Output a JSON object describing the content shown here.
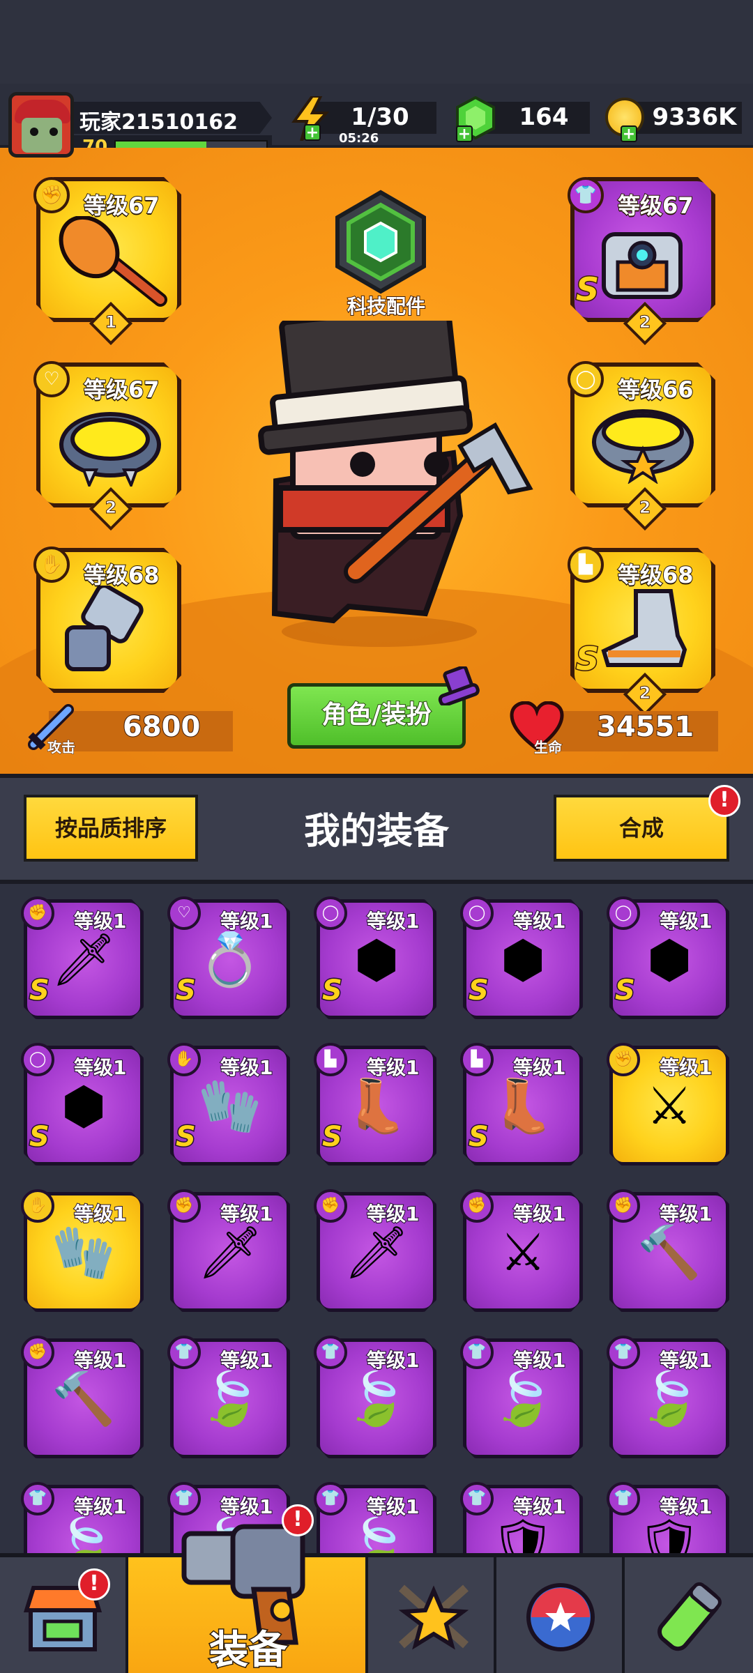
{
  "player": {
    "name": "玩家21510162",
    "level": "70",
    "xp_fraction": 0.6
  },
  "resources": {
    "energy": {
      "value": "1/30",
      "timer": "05:26",
      "icon": "lightning-icon"
    },
    "gems": {
      "value": "164",
      "icon": "green-gem-icon"
    },
    "coins": {
      "value": "9336K",
      "icon": "gold-coin-icon"
    }
  },
  "tech_parts": {
    "label": "科技配件"
  },
  "equipped": {
    "weapon": {
      "level": "等级67",
      "count": "1",
      "icon": "hammer-icon"
    },
    "necklace": {
      "level": "等级67",
      "count": "2",
      "icon": "spiked-collar-icon"
    },
    "gloves": {
      "level": "等级68",
      "count": "",
      "icon": "gauntlet-icon"
    },
    "armor": {
      "level": "等级67",
      "count": "2",
      "icon": "robot-armor-icon",
      "grade": "S"
    },
    "belt": {
      "level": "等级66",
      "count": "2",
      "icon": "star-belt-icon"
    },
    "boots": {
      "level": "等级68",
      "count": "2",
      "icon": "boot-icon",
      "grade": "S"
    }
  },
  "stats": {
    "attack_label": "攻击",
    "attack": "6800",
    "hp_label": "生命",
    "hp": "34551"
  },
  "role_button": "角色/装扮",
  "panel": {
    "sort_button": "按品质排序",
    "title": "我的装备",
    "merge_button": "合成",
    "merge_alert": "!"
  },
  "inventory": [
    {
      "level": "等级1",
      "grade": "S",
      "rarity": "purple",
      "slot": "weapon",
      "icon": "flame-sword-icon"
    },
    {
      "level": "等级1",
      "grade": "S",
      "rarity": "purple",
      "slot": "necklace",
      "icon": "star-ring-icon"
    },
    {
      "level": "等级1",
      "grade": "S",
      "rarity": "purple",
      "slot": "belt",
      "icon": "gem-belt-icon"
    },
    {
      "level": "等级1",
      "grade": "S",
      "rarity": "purple",
      "slot": "belt",
      "icon": "gem-belt-icon"
    },
    {
      "level": "等级1",
      "grade": "S",
      "rarity": "purple",
      "slot": "belt",
      "icon": "gem-belt-icon"
    },
    {
      "level": "等级1",
      "grade": "S",
      "rarity": "purple",
      "slot": "belt",
      "icon": "gem-belt-icon"
    },
    {
      "level": "等级1",
      "grade": "S",
      "rarity": "purple",
      "slot": "gloves",
      "icon": "mech-glove-icon"
    },
    {
      "level": "等级1",
      "grade": "S",
      "rarity": "purple",
      "slot": "boots",
      "icon": "mech-boot-icon"
    },
    {
      "level": "等级1",
      "grade": "S",
      "rarity": "purple",
      "slot": "boots",
      "icon": "mech-boot-icon"
    },
    {
      "level": "等级1",
      "grade": "",
      "rarity": "gold",
      "slot": "weapon",
      "icon": "katana-icon"
    },
    {
      "level": "等级1",
      "grade": "",
      "rarity": "gold",
      "slot": "gloves",
      "icon": "gauntlet-icon"
    },
    {
      "level": "等级1",
      "grade": "",
      "rarity": "purple",
      "slot": "weapon",
      "icon": "kunai-icon"
    },
    {
      "level": "等级1",
      "grade": "",
      "rarity": "purple",
      "slot": "weapon",
      "icon": "kunai-icon"
    },
    {
      "level": "等级1",
      "grade": "",
      "rarity": "purple",
      "slot": "weapon",
      "icon": "katana-icon"
    },
    {
      "level": "等级1",
      "grade": "",
      "rarity": "purple",
      "slot": "weapon",
      "icon": "hammer-icon"
    },
    {
      "level": "等级1",
      "grade": "",
      "rarity": "purple",
      "slot": "weapon",
      "icon": "hammer-icon"
    },
    {
      "level": "等级1",
      "grade": "",
      "rarity": "purple",
      "slot": "armor",
      "icon": "leaf-armor-icon"
    },
    {
      "level": "等级1",
      "grade": "",
      "rarity": "purple",
      "slot": "armor",
      "icon": "leaf-armor-icon"
    },
    {
      "level": "等级1",
      "grade": "",
      "rarity": "purple",
      "slot": "armor",
      "icon": "leaf-armor-icon"
    },
    {
      "level": "等级1",
      "grade": "",
      "rarity": "purple",
      "slot": "armor",
      "icon": "leaf-armor-icon"
    },
    {
      "level": "等级1",
      "grade": "",
      "rarity": "purple",
      "slot": "armor",
      "icon": "leaf-armor-icon"
    },
    {
      "level": "等级1",
      "grade": "",
      "rarity": "purple",
      "slot": "armor",
      "icon": "leaf-armor-icon"
    },
    {
      "level": "等级1",
      "grade": "",
      "rarity": "purple",
      "slot": "armor",
      "icon": "leaf-armor-icon"
    },
    {
      "level": "等级1",
      "grade": "",
      "rarity": "purple",
      "slot": "armor",
      "icon": "silver-armor-icon"
    },
    {
      "level": "等级1",
      "grade": "",
      "rarity": "purple",
      "slot": "armor",
      "icon": "silver-armor-icon"
    }
  ],
  "nav": {
    "shop_alert": "!",
    "equip_label": "装备",
    "equip_alert": "!",
    "tabs": [
      "shop-icon",
      "gun-icon",
      "crossed-swords-star-icon",
      "star-ball-icon",
      "dna-capsule-icon"
    ]
  },
  "colors": {
    "gold": "#ffd21c",
    "purple": "#a93bd0",
    "orange_bg": "#fb9a18",
    "green_button": "#5ccf33",
    "alert_red": "#e01e2a"
  }
}
